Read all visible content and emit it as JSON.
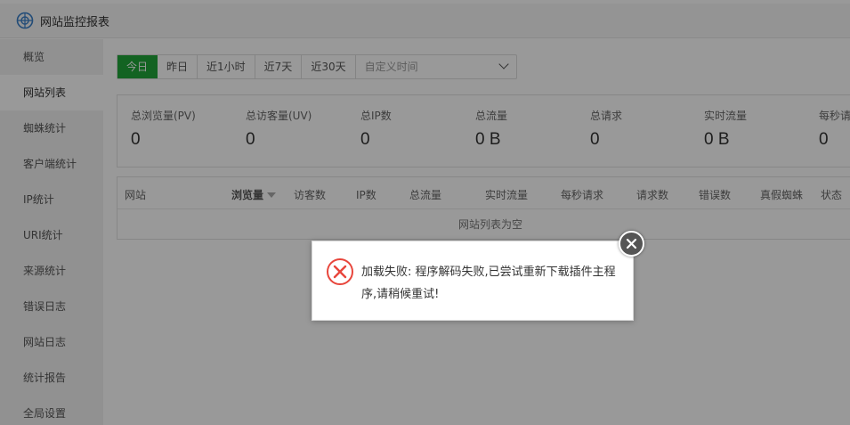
{
  "app": {
    "title": "网站监控报表"
  },
  "sidebar": {
    "items": [
      {
        "label": "概览",
        "active": false
      },
      {
        "label": "网站列表",
        "active": true
      },
      {
        "label": "蜘蛛统计",
        "active": false
      },
      {
        "label": "客户端统计",
        "active": false
      },
      {
        "label": "IP统计",
        "active": false
      },
      {
        "label": "URI统计",
        "active": false
      },
      {
        "label": "来源统计",
        "active": false
      },
      {
        "label": "错误日志",
        "active": false
      },
      {
        "label": "网站日志",
        "active": false
      },
      {
        "label": "统计报告",
        "active": false
      },
      {
        "label": "全局设置",
        "active": false
      }
    ]
  },
  "date_filter": {
    "buttons": [
      "今日",
      "昨日",
      "近1小时",
      "近7天",
      "近30天"
    ],
    "active": "今日",
    "custom_placeholder": "自定义时间"
  },
  "stats": [
    {
      "label": "总浏览量(PV)",
      "value": "0"
    },
    {
      "label": "总访客量(UV)",
      "value": "0"
    },
    {
      "label": "总IP数",
      "value": "0"
    },
    {
      "label": "总流量",
      "value": "0 B"
    },
    {
      "label": "总请求",
      "value": "0"
    },
    {
      "label": "实时流量",
      "value": "0 B"
    },
    {
      "label": "每秒请",
      "value": "0"
    }
  ],
  "table": {
    "columns": [
      "网站",
      "浏览量",
      "访客数",
      "IP数",
      "总流量",
      "实时流量",
      "每秒请求",
      "请求数",
      "错误数",
      "真假蜘蛛",
      "状态"
    ],
    "sorted_column": "浏览量",
    "empty_text": "网站列表为空"
  },
  "dialog": {
    "message": "加载失败: 程序解码失败,已尝试重新下载插件主程序,请稍候重试!"
  },
  "colors": {
    "accent": "#20a53a",
    "error": "#e8463c"
  }
}
